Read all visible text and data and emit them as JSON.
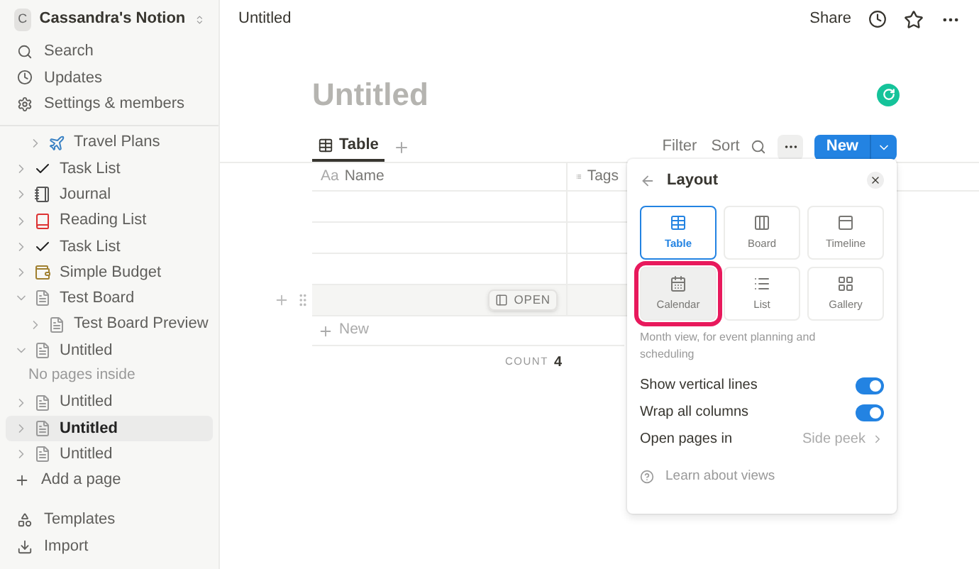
{
  "sidebar": {
    "workspace": {
      "initial": "C",
      "name": "Cassandra's Notion"
    },
    "nav": [
      {
        "kind": "search",
        "label": "Search"
      },
      {
        "kind": "updates",
        "label": "Updates"
      },
      {
        "kind": "settings",
        "label": "Settings & members"
      }
    ],
    "tree_continued": [
      {
        "kind": "plane",
        "label": "Travel Plans",
        "expanded": false,
        "selected": false
      }
    ],
    "tree": [
      {
        "kind": "check",
        "label": "Task List",
        "expanded": false,
        "selected": false
      },
      {
        "kind": "journal",
        "label": "Journal",
        "expanded": false,
        "selected": false
      },
      {
        "kind": "book",
        "label": "Reading List",
        "expanded": false,
        "selected": false
      },
      {
        "kind": "check",
        "label": "Task List",
        "expanded": false,
        "selected": false
      },
      {
        "kind": "budget",
        "label": "Simple Budget",
        "expanded": false,
        "selected": false
      },
      {
        "kind": "page",
        "label": "Test Board",
        "expanded": true,
        "selected": false,
        "children": [
          {
            "kind": "page",
            "label": "Test Board Preview",
            "expanded": false,
            "selected": false
          }
        ]
      },
      {
        "kind": "page",
        "label": "Untitled",
        "expanded": true,
        "selected": false,
        "empty_note": "No pages inside"
      },
      {
        "kind": "page",
        "label": "Untitled",
        "expanded": false,
        "selected": false
      },
      {
        "kind": "page",
        "label": "Untitled",
        "expanded": false,
        "selected": true
      },
      {
        "kind": "page",
        "label": "Untitled",
        "expanded": false,
        "selected": false
      }
    ],
    "add_page": "Add a page",
    "footer": [
      {
        "kind": "templates",
        "label": "Templates"
      },
      {
        "kind": "import",
        "label": "Import"
      }
    ]
  },
  "topbar": {
    "breadcrumb": "Untitled",
    "share": "Share"
  },
  "page": {
    "title": "Untitled"
  },
  "views": {
    "tabs": [
      {
        "label": "Table",
        "selected": true
      }
    ],
    "filter": "Filter",
    "sort": "Sort",
    "new_button": "New"
  },
  "table": {
    "columns": [
      {
        "kind": "title",
        "label": "Name",
        "prefix": "Aa"
      },
      {
        "kind": "multi",
        "label": "Tags"
      }
    ],
    "rows": [
      {
        "hovered": false
      },
      {
        "hovered": false
      },
      {
        "hovered": false
      },
      {
        "hovered": true,
        "open_label": "OPEN"
      }
    ],
    "new_row": "New",
    "count_label": "COUNT",
    "count_value": "4"
  },
  "layout_panel": {
    "title": "Layout",
    "layouts": [
      {
        "kind": "table",
        "label": "Table",
        "selected": true,
        "highlighted": false
      },
      {
        "kind": "board",
        "label": "Board",
        "selected": false,
        "highlighted": false
      },
      {
        "kind": "timeline",
        "label": "Timeline",
        "selected": false,
        "highlighted": false
      },
      {
        "kind": "calendar",
        "label": "Calendar",
        "selected": false,
        "highlighted": true
      },
      {
        "kind": "list",
        "label": "List",
        "selected": false,
        "highlighted": false
      },
      {
        "kind": "gallery",
        "label": "Gallery",
        "selected": false,
        "highlighted": false
      }
    ],
    "description": "Month view, for event planning and scheduling",
    "toggles": [
      {
        "label": "Show vertical lines",
        "on": true
      },
      {
        "label": "Wrap all columns",
        "on": true
      }
    ],
    "open_pages": {
      "label": "Open pages in",
      "value": "Side peek"
    },
    "learn": "Learn about views"
  }
}
